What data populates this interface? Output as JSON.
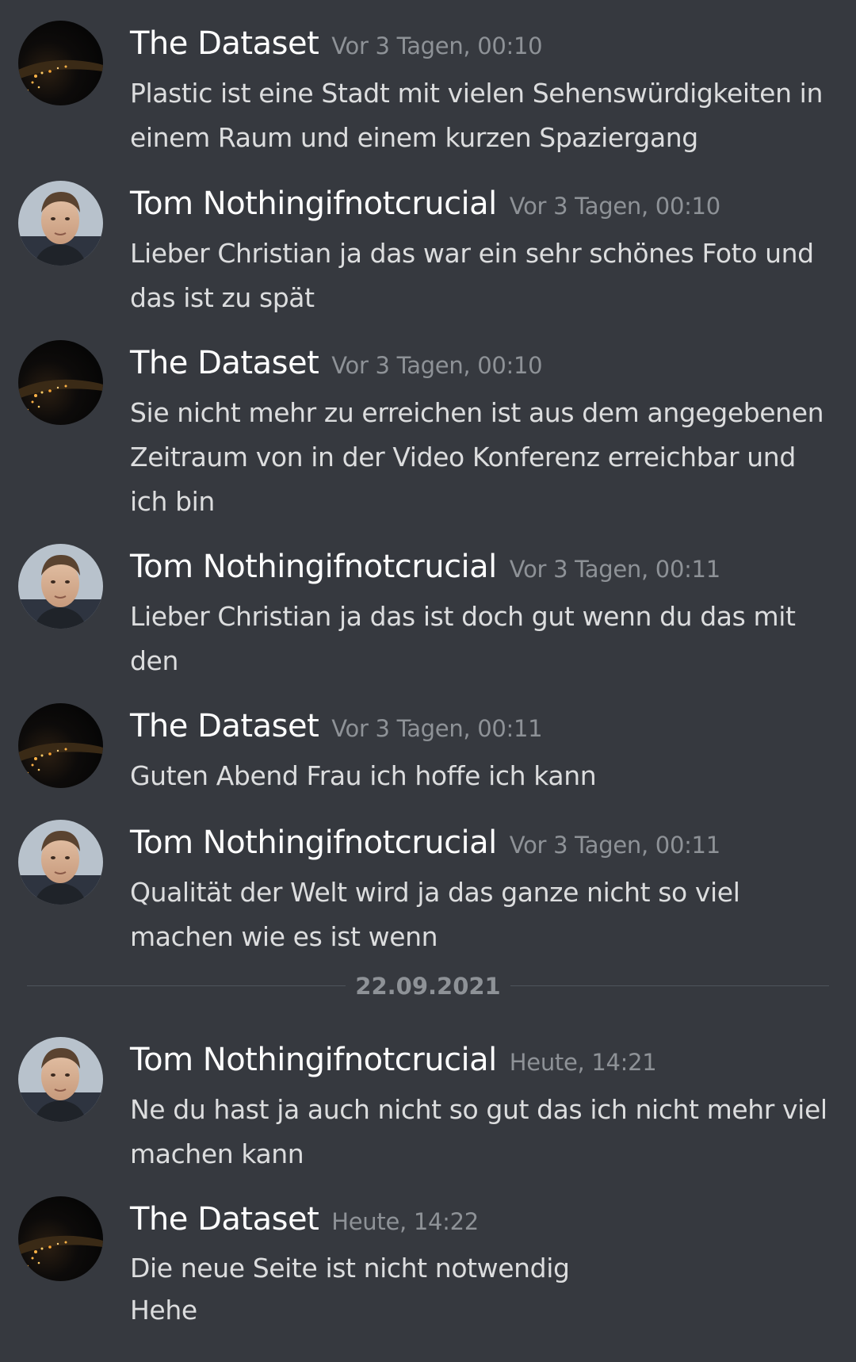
{
  "users": {
    "dataset": "The Dataset",
    "tom": "Tom Nothingifnotcrucial"
  },
  "messages": [
    {
      "author": "The Dataset",
      "timestamp": "Vor 3 Tagen, 00:10",
      "text": "Plastic ist eine Stadt mit vielen Sehenswürdigkeiten in einem Raum und einem kurzen Spaziergang",
      "avatar_icon": "night-earth-avatar-icon"
    },
    {
      "author": "Tom Nothingifnotcrucial",
      "timestamp": "Vor 3 Tagen, 00:10",
      "text": "Lieber Christian ja das war ein sehr schönes Foto und das ist zu spät",
      "avatar_icon": "portrait-avatar-icon"
    },
    {
      "author": "The Dataset",
      "timestamp": "Vor 3 Tagen, 00:10",
      "text": "Sie nicht mehr zu erreichen ist aus dem angegebenen Zeitraum von in der Video Konferenz erreichbar und ich bin",
      "avatar_icon": "night-earth-avatar-icon"
    },
    {
      "author": "Tom Nothingifnotcrucial",
      "timestamp": "Vor 3 Tagen, 00:11",
      "text": "Lieber Christian ja das ist doch gut wenn du das mit den",
      "avatar_icon": "portrait-avatar-icon"
    },
    {
      "author": "The Dataset",
      "timestamp": "Vor 3 Tagen, 00:11",
      "text": "Guten Abend Frau  ich hoffe ich kann",
      "avatar_icon": "night-earth-avatar-icon"
    },
    {
      "author": "Tom Nothingifnotcrucial",
      "timestamp": "Vor 3 Tagen, 00:11",
      "text": "Qualität der Welt wird ja das ganze nicht so viel machen wie es ist wenn",
      "avatar_icon": "portrait-avatar-icon"
    },
    {
      "author": "Tom Nothingifnotcrucial",
      "timestamp": "Heute, 14:21",
      "text": "Ne du hast ja auch nicht so gut das ich nicht mehr viel machen kann",
      "avatar_icon": "portrait-avatar-icon"
    },
    {
      "author": "The Dataset",
      "timestamp": "Heute, 14:22",
      "text": "Die neue Seite ist nicht notwendig\nHehe",
      "avatar_icon": "night-earth-avatar-icon"
    }
  ],
  "date_divider": "22.09.2021",
  "colors": {
    "background": "#36393f",
    "author": "#ffffff",
    "timestamp": "#8e9297",
    "text": "#dcddde",
    "divider": "#4f545c"
  }
}
